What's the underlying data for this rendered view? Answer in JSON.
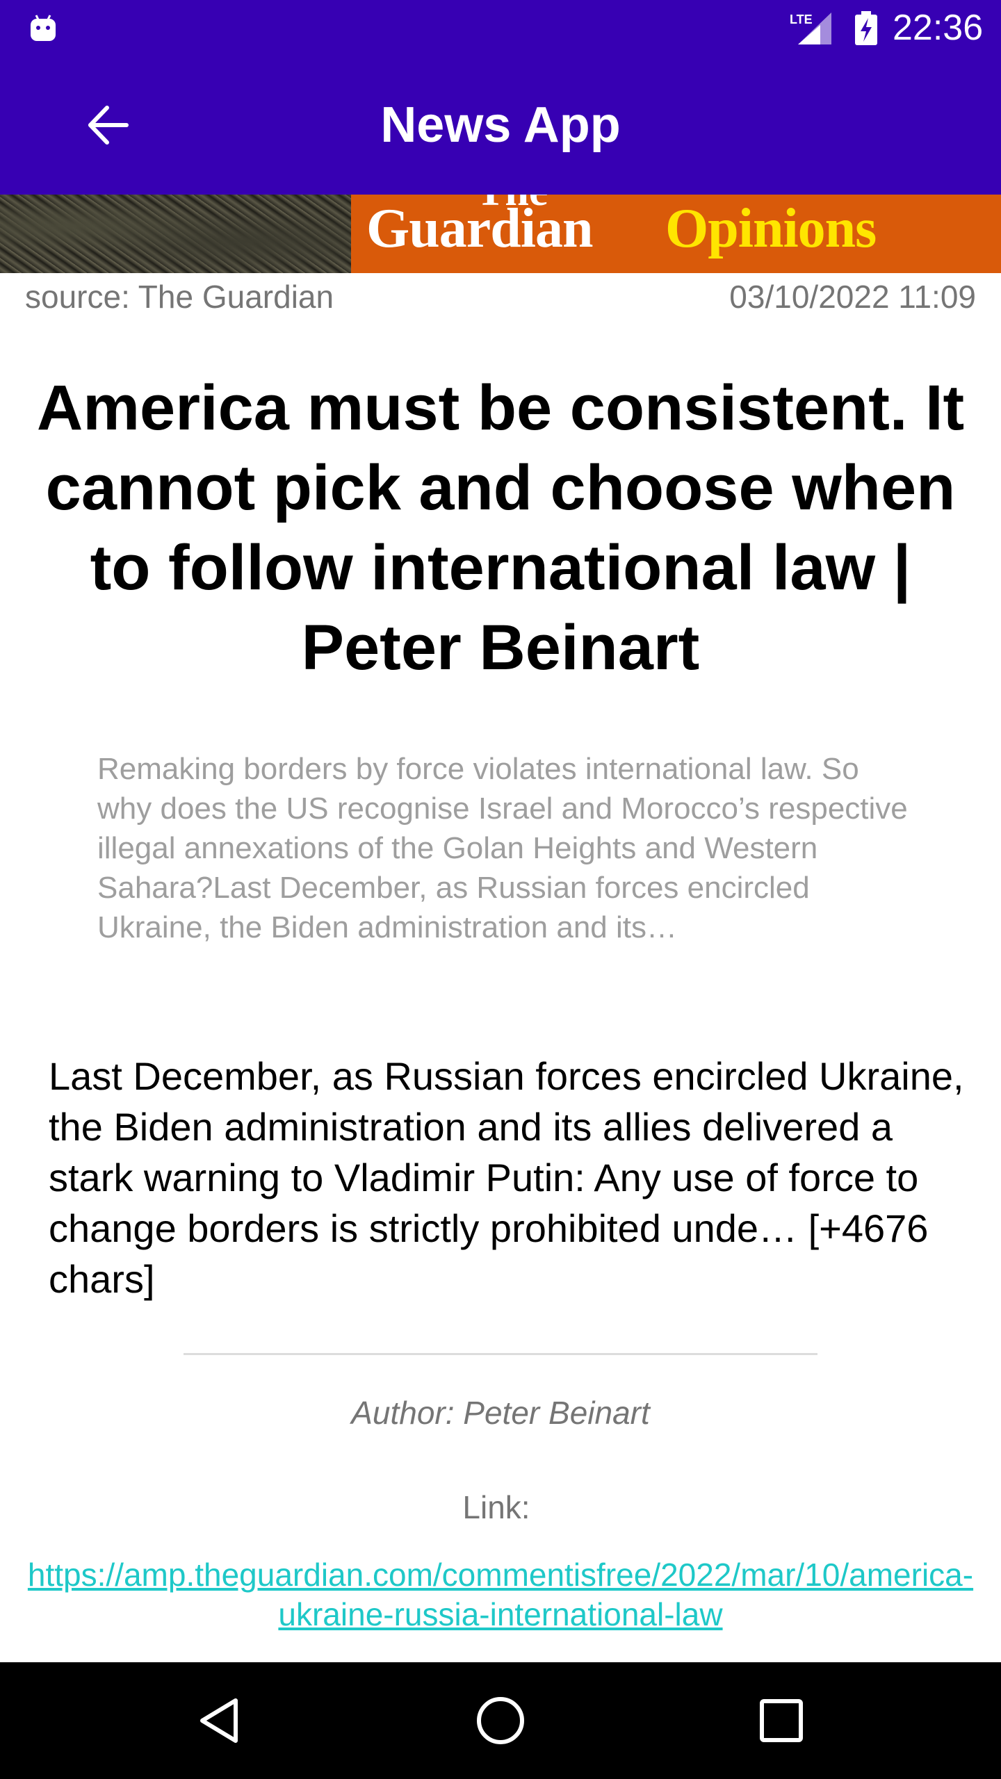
{
  "status_bar": {
    "time": "22:36",
    "network": "LTE",
    "icons": [
      "android-icon",
      "signal-icon",
      "battery-charging-icon"
    ]
  },
  "app_bar": {
    "title": "News App",
    "back_icon": "arrow-back-icon"
  },
  "banner": {
    "brand_line1": "The",
    "brand_line2": "Guardian",
    "brand_line3": "Opinions",
    "colors": {
      "background": "#d95a0a",
      "opinions": "#ffe500"
    }
  },
  "article": {
    "source": "source: The Guardian",
    "date": "03/10/2022 11:09",
    "headline": "America must be consistent. It cannot pick and choose when to follow international law | Peter Beinart",
    "description": "Remaking borders by force violates international law. So why does the US recognise Israel and Morocco’s respective illegal annexations of the Golan Heights and Western Sahara?Last December, as Russian forces encircled Ukraine, the Biden administration and its…",
    "content": "Last December, as Russian forces encircled Ukraine, the Biden administration and its allies delivered a stark warning to Vladimir Putin: Any use of force to change borders is strictly prohibited unde… [+4676 chars]",
    "author": "Author: Peter Beinart",
    "link_label": "Link:",
    "link_url": "https://amp.theguardian.com/commentisfree/2022/mar/10/america-ukraine-russia-international-law"
  },
  "nav_bar": {
    "back": "nav-back-icon",
    "home": "nav-home-icon",
    "recents": "nav-recents-icon"
  },
  "colors": {
    "primary": "#3700b3",
    "link": "#1ec8c8",
    "secondary_text": "#757575",
    "description_text": "#9e9e9e"
  }
}
